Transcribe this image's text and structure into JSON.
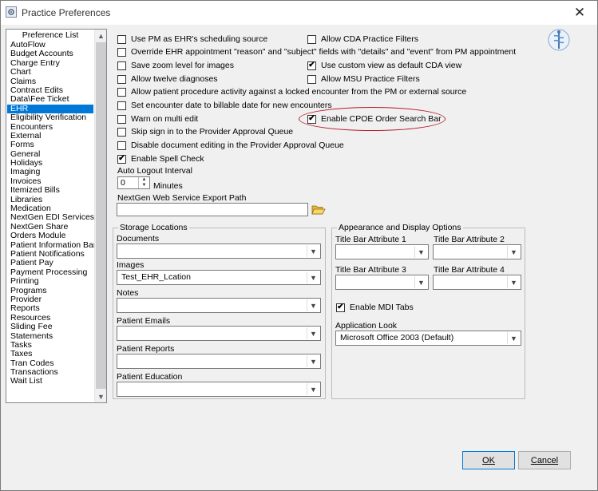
{
  "window": {
    "title": "Practice Preferences",
    "close_glyph": "✕"
  },
  "list": {
    "header": "Preference List",
    "items": [
      "AutoFlow",
      "Budget Accounts",
      "Charge Entry",
      "Chart",
      "Claims",
      "Contract Edits",
      "Data\\Fee Ticket",
      "EHR",
      "Eligibility Verification",
      "Encounters",
      "External",
      "Forms",
      "General",
      "Holidays",
      "Imaging",
      "Invoices",
      "Itemized Bills",
      "Libraries",
      "Medication",
      "NextGen EDI Services",
      "NextGen Share",
      "Orders Module",
      "Patient Information Bar",
      "Patient Notifications",
      "Patient Pay",
      "Payment Processing",
      "Printing",
      "Programs",
      "Provider",
      "Reports",
      "Resources",
      "Sliding Fee",
      "Statements",
      "Tasks",
      "Taxes",
      "Tran Codes",
      "Transactions",
      "Wait List"
    ],
    "selected": "EHR"
  },
  "options": {
    "use_pm": {
      "label": "Use PM as EHR's scheduling source",
      "checked": false
    },
    "override": {
      "label": "Override EHR appointment \"reason\" and \"subject\" fields with \"details\" and \"event\" from PM appointment",
      "checked": false
    },
    "save_zoom": {
      "label": "Save zoom level for images",
      "checked": false
    },
    "allow_twelve": {
      "label": "Allow twelve diagnoses",
      "checked": false
    },
    "allow_patient_proc": {
      "label": "Allow patient procedure activity against a locked encounter from the PM or external source",
      "checked": false
    },
    "set_encounter_date": {
      "label": "Set encounter date to billable date for new encounters",
      "checked": false
    },
    "warn_multi": {
      "label": "Warn on multi edit",
      "checked": false
    },
    "skip_sign_in": {
      "label": "Skip sign in to the Provider Approval Queue",
      "checked": false
    },
    "disable_doc_edit": {
      "label": "Disable document editing in the Provider Approval Queue",
      "checked": false
    },
    "enable_spell": {
      "label": "Enable Spell Check",
      "checked": true
    },
    "allow_cda": {
      "label": "Allow CDA Practice Filters",
      "checked": false
    },
    "use_custom_view": {
      "label": "Use custom view as default CDA view",
      "checked": true
    },
    "allow_msu": {
      "label": "Allow MSU Practice Filters",
      "checked": false
    },
    "enable_cpoe": {
      "label": "Enable CPOE Order Search Bar",
      "checked": true
    }
  },
  "auto_logout": {
    "label": "Auto Logout Interval",
    "value": "0",
    "unit": "Minutes"
  },
  "export_path": {
    "label": "NextGen Web Service Export Path",
    "value": ""
  },
  "storage": {
    "title": "Storage Locations",
    "documents": {
      "label": "Documents",
      "value": ""
    },
    "images": {
      "label": "Images",
      "value": "Test_EHR_Lcation"
    },
    "notes": {
      "label": "Notes",
      "value": ""
    },
    "patient_emails": {
      "label": "Patient Emails",
      "value": ""
    },
    "patient_reports": {
      "label": "Patient Reports",
      "value": ""
    },
    "patient_education": {
      "label": "Patient Education",
      "value": ""
    }
  },
  "appearance": {
    "title": "Appearance and Display Options",
    "attr1": {
      "label": "Title Bar Attribute 1",
      "value": ""
    },
    "attr2": {
      "label": "Title Bar Attribute 2",
      "value": ""
    },
    "attr3": {
      "label": "Title Bar Attribute 3",
      "value": ""
    },
    "attr4": {
      "label": "Title Bar Attribute 4",
      "value": ""
    },
    "mdi_tabs": {
      "label": "Enable MDI Tabs",
      "checked": true
    },
    "app_look": {
      "label": "Application Look",
      "value": "Microsoft Office 2003 (Default)"
    }
  },
  "buttons": {
    "ok": "OK",
    "cancel": "Cancel"
  },
  "colors": {
    "selection": "#0078d7",
    "highlight_ellipse": "#b81c2a",
    "dialog_bg": "#f0f0f0"
  },
  "icons": {
    "app": "gear-window-icon",
    "corner_logo": "caduceus-logo-icon",
    "folder": "open-folder-icon",
    "checkmark": "✔"
  }
}
